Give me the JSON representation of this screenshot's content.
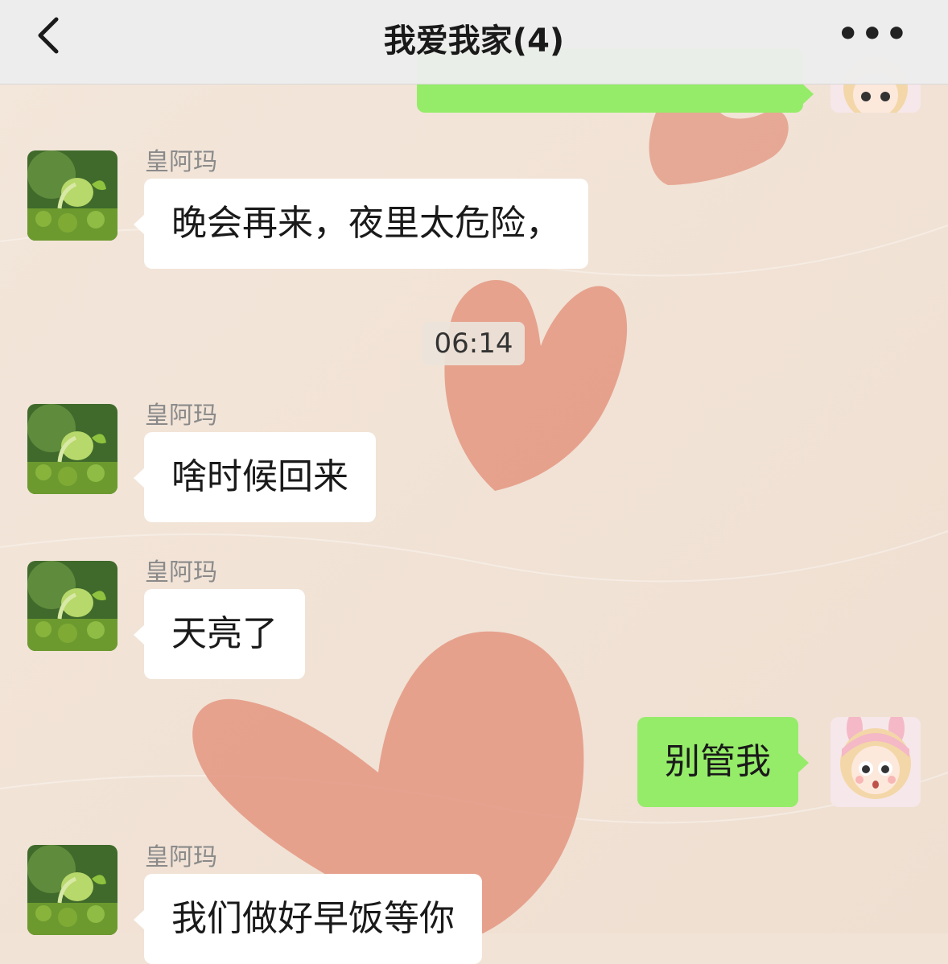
{
  "header": {
    "title": "我爱我家(4)",
    "back_icon": "chevron-left-icon",
    "more_label": "•••"
  },
  "time_divider": "06:14",
  "messages": [
    {
      "sender": "",
      "text": "",
      "side": "right"
    },
    {
      "sender": "皇阿玛",
      "text": "晚会再来，夜里太危险，",
      "side": "left"
    },
    {
      "sender": "皇阿玛",
      "text": "啥时候回来",
      "side": "left"
    },
    {
      "sender": "皇阿玛",
      "text": "天亮了",
      "side": "left"
    },
    {
      "sender": "",
      "text": "别管我",
      "side": "right"
    },
    {
      "sender": "皇阿玛",
      "text": "我们做好早饭等你",
      "side": "left"
    }
  ],
  "colors": {
    "accent_bubble": "#95ec69",
    "background": "#f1e3d6",
    "heart": "#e49a85"
  }
}
